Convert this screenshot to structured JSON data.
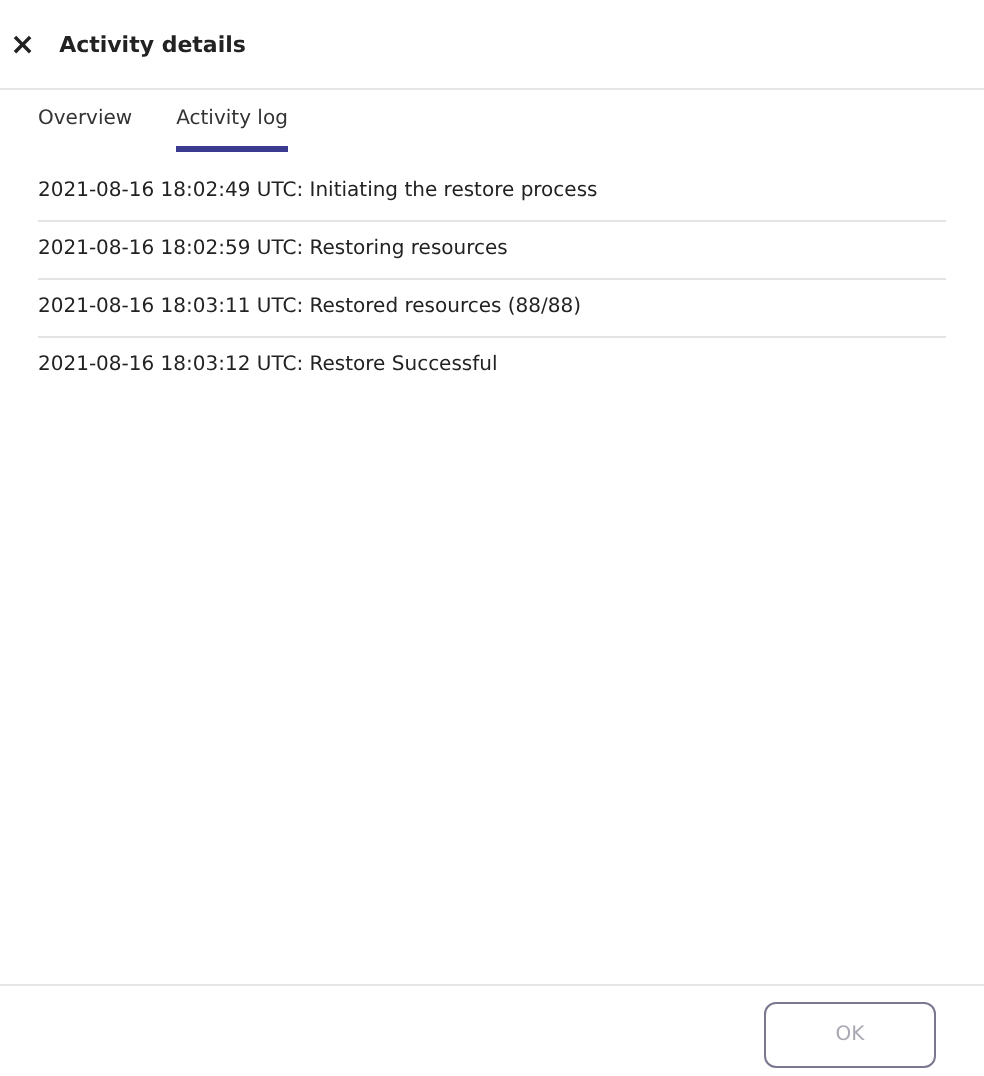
{
  "header": {
    "close_glyph": "×",
    "title": "Activity details"
  },
  "tabs": [
    {
      "label": "Overview",
      "selected": false
    },
    {
      "label": "Activity log",
      "selected": true
    }
  ],
  "log_entries": [
    "2021-08-16 18:02:49 UTC: Initiating the restore process",
    "2021-08-16 18:02:59 UTC: Restoring resources",
    "2021-08-16 18:03:11 UTC: Restored resources (88/88)",
    "2021-08-16 18:03:12 UTC: Restore Successful"
  ],
  "footer": {
    "ok_button": {
      "label": "OK",
      "disabled": true
    }
  }
}
